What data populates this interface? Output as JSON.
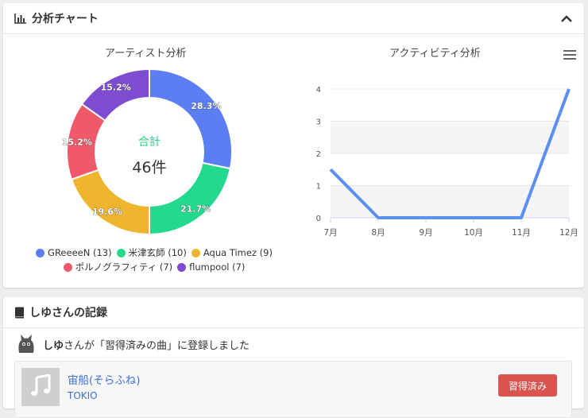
{
  "panel": {
    "title": "分析チャート",
    "icon": "bar-chart-icon",
    "collapse_icon": "chevron-up-icon"
  },
  "donut": {
    "title": "アーティスト分析",
    "center_label": "合計",
    "center_value": "46件"
  },
  "line_chart": {
    "title": "アクティビティ分析",
    "menu_icon": "hamburger-menu-icon"
  },
  "legend": [
    {
      "label": "GReeeeN (13)"
    },
    {
      "label": "米津玄師 (10)"
    },
    {
      "label": "Aqua Timez (9)"
    },
    {
      "label": "ポルノグラフィティ (7)"
    },
    {
      "label": "flumpool (7)"
    }
  ],
  "chart_data": [
    {
      "type": "pie",
      "title": "アーティスト分析",
      "categories": [
        "GReeeeN",
        "米津玄師",
        "Aqua Timez",
        "ポルノグラフィティ",
        "flumpool"
      ],
      "values": [
        13,
        10,
        9,
        7,
        7
      ],
      "labels": [
        "28.3%",
        "21.7%",
        "19.6%",
        "15.2%",
        "15.2%"
      ],
      "colors": [
        "#5b7ff2",
        "#22d98e",
        "#f0b52e",
        "#f0596a",
        "#7d4cd0"
      ],
      "legend": "bottom"
    },
    {
      "type": "line",
      "title": "アクティビティ分析",
      "x": [
        "7月",
        "8月",
        "9月",
        "10月",
        "11月",
        "12月"
      ],
      "values": [
        1.5,
        0,
        0,
        0,
        0,
        4
      ],
      "yticks": [
        "0",
        "1",
        "2",
        "3",
        "4"
      ],
      "ylim": [
        0,
        4
      ],
      "color": "#5b8ff0",
      "grid": true
    }
  ],
  "record": {
    "title": "しゆさんの記録",
    "icon": "book-icon",
    "user": "しゆ",
    "message": "さんが「習得済みの曲」に登録しました",
    "song_title": "宙船(そらふね)",
    "song_artist": "TOKIO",
    "button_label": "習得済み",
    "thumb_icon": "music-note-icon",
    "avatar_icon": "cat-avatar-icon"
  }
}
